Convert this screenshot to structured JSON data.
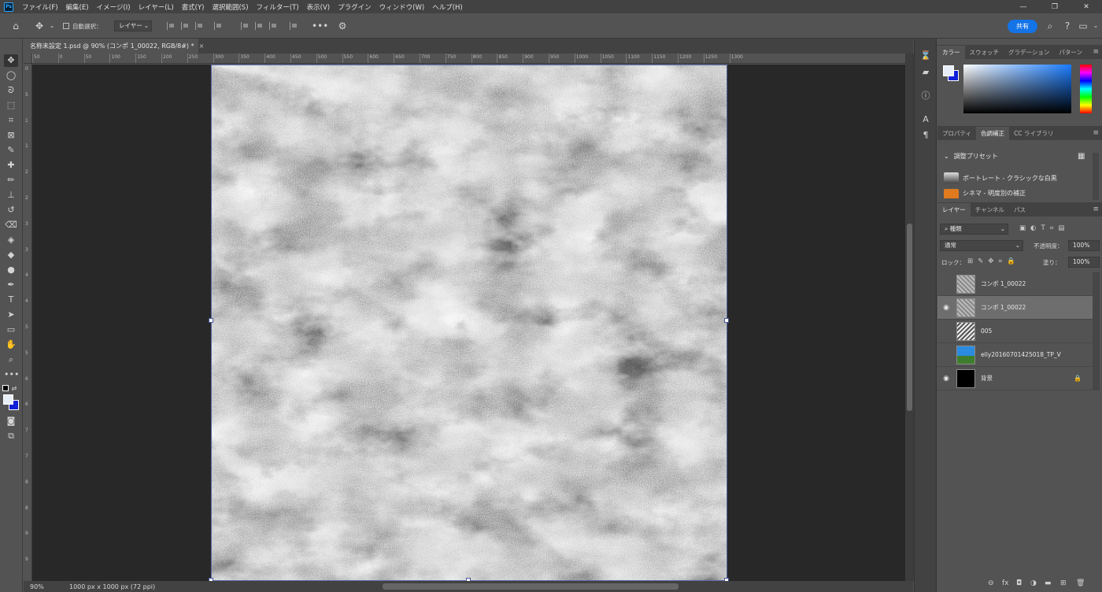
{
  "app": {
    "logo_text": "Ps"
  },
  "menu": [
    "ファイル(F)",
    "編集(E)",
    "イメージ(I)",
    "レイヤー(L)",
    "書式(Y)",
    "選択範囲(S)",
    "フィルター(T)",
    "表示(V)",
    "プラグイン",
    "ウィンドウ(W)",
    "ヘルプ(H)"
  ],
  "window_controls": [
    "—",
    "❐",
    "✕"
  ],
  "options_bar": {
    "auto_select_label": "自動選択：",
    "auto_select_value": "レイヤー",
    "share_label": "共有"
  },
  "document": {
    "tab_title": "名称未設定 1.psd @ 90% (コンポ 1_00022, RGB/8#) *",
    "close_label": "×",
    "zoom": "90%",
    "doc_size": "1000 px x 1000 px (72 ppi)"
  },
  "ruler_top_ticks": [
    "50",
    "0",
    "50",
    "100",
    "150",
    "200",
    "250",
    "300",
    "350",
    "400",
    "450",
    "500",
    "550",
    "600",
    "650",
    "700",
    "750",
    "800",
    "850",
    "900",
    "950",
    "1000",
    "1050",
    "1100",
    "1150",
    "1200",
    "1250",
    "1300"
  ],
  "ruler_left_ticks": [
    "0",
    "5",
    "1",
    "1",
    "2",
    "2",
    "3",
    "3",
    "4",
    "4",
    "5",
    "5",
    "6",
    "6",
    "7",
    "7",
    "8",
    "8",
    "9",
    "9"
  ],
  "color_panel": {
    "tabs": [
      "カラー",
      "スウォッチ",
      "グラデーション",
      "パターン"
    ],
    "foreground": "#e8eef7",
    "background": "#1020d8"
  },
  "adjustments_panel": {
    "tabs": [
      "プロパティ",
      "色調補正",
      "CC ライブラリ"
    ],
    "section_title": "調整プリセット",
    "presets": [
      "ポートレート - クラシックな白黒",
      "シネマ - 明度別の補正"
    ]
  },
  "layers_panel": {
    "tabs": [
      "レイヤー",
      "チャンネル",
      "パス"
    ],
    "filter_label": "種類",
    "blend_mode": "通常",
    "opacity_label": "不透明度：",
    "opacity_value": "100%",
    "lock_label": "ロック：",
    "fill_label": "塗り：",
    "fill_value": "100%",
    "layers": [
      {
        "name": "コンポ 1_00022",
        "visible": false,
        "selected": false
      },
      {
        "name": "コンポ 1_00022",
        "visible": true,
        "selected": true
      },
      {
        "name": "005",
        "visible": false,
        "selected": false
      },
      {
        "name": "elly20160701425018_TP_V",
        "visible": false,
        "selected": false
      },
      {
        "name": "背景",
        "visible": true,
        "selected": false,
        "locked": true
      }
    ]
  },
  "colors": {
    "accent": "#1473e6",
    "panel_bg": "#535353",
    "canvas_bg": "#282828"
  }
}
